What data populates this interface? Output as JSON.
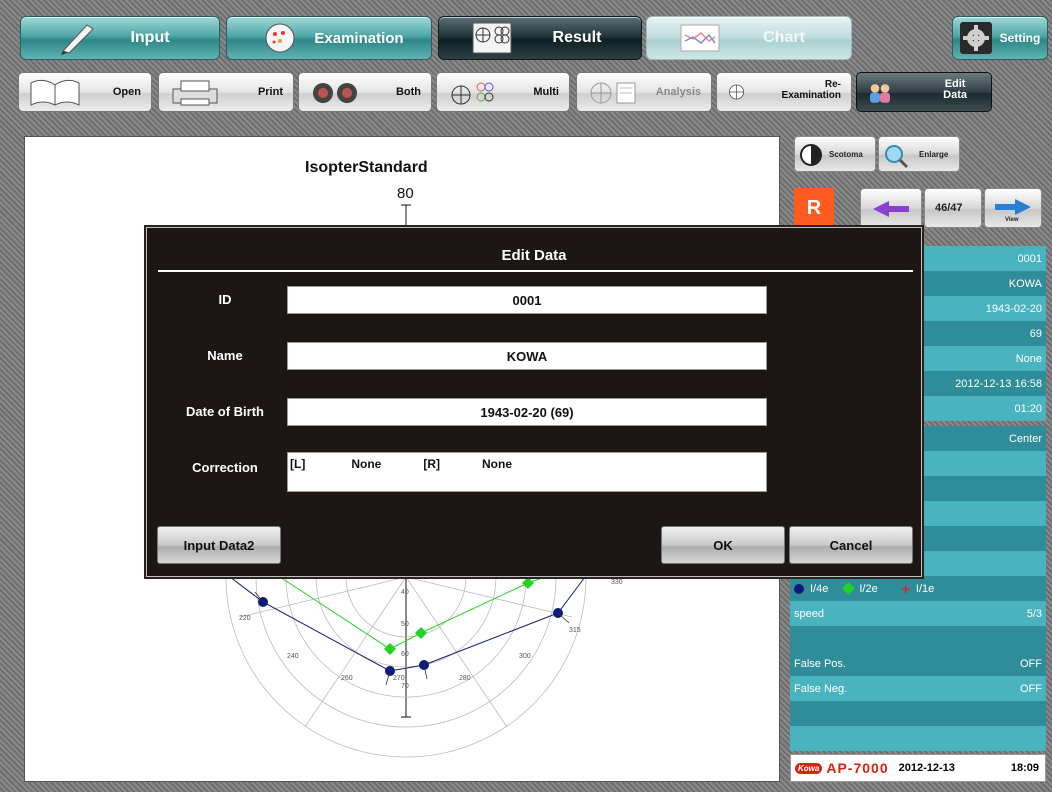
{
  "tabs": {
    "input": "Input",
    "examination": "Examination",
    "result": "Result",
    "chart": "Chart",
    "setting": "Setting"
  },
  "toolbar": {
    "open": "Open",
    "print": "Print",
    "both": "Both",
    "multi": "Multi",
    "analysis": "Analysis",
    "reexam_line1": "Re-",
    "reexam_line2": "Examination",
    "edit_line1": "Edit",
    "edit_line2": "Data"
  },
  "chart": {
    "title": "IsopterStandard",
    "top_tick": "80",
    "angles": [
      "220",
      "240",
      "260",
      "270",
      "280",
      "300",
      "315",
      "330"
    ],
    "scale": [
      "40",
      "50",
      "60",
      "70"
    ],
    "legend": [
      "I/4e",
      "I/2e",
      "I/1e"
    ]
  },
  "side": {
    "scotoma": "Scotoma",
    "enlarge": "Enlarge",
    "eye": "R",
    "page": "46/47",
    "view": "View",
    "rows": [
      {
        "label": "",
        "value": "0001"
      },
      {
        "label": "",
        "value": "KOWA"
      },
      {
        "label": "",
        "value": "1943-02-20"
      },
      {
        "label": "",
        "value": "69"
      },
      {
        "label": "",
        "value": "None"
      },
      {
        "label": "",
        "value": "2012-12-13 16:58"
      },
      {
        "label": "",
        "value": "01:20"
      }
    ],
    "center": "Center",
    "speed_label": "speed",
    "speed_value": "5/3",
    "false_pos_label": "False Pos.",
    "false_pos_value": "OFF",
    "false_neg_label": "False Neg.",
    "false_neg_value": "OFF",
    "footer_brand": "Kowa",
    "footer_model": "AP-7000",
    "footer_date": "2012-12-13",
    "footer_time": "18:09"
  },
  "modal": {
    "title": "Edit Data",
    "id_label": "ID",
    "id_value": "0001",
    "name_label": "Name",
    "name_value": "KOWA",
    "dob_label": "Date of Birth",
    "dob_value": "1943-02-20 (69)",
    "correction_label": "Correction",
    "corr_l_tag": "[L]",
    "corr_l_value": "None",
    "corr_r_tag": "[R]",
    "corr_r_value": "None",
    "input_data2": "Input Data2",
    "ok": "OK",
    "cancel": "Cancel"
  },
  "colors": {
    "teal_light": "#4ab3c0",
    "teal_dark": "#2f8d99",
    "isopter_blue": "#0d1a7a",
    "isopter_green": "#22d422",
    "isopter_red": "#e02020",
    "eye_badge": "#ff5a1f"
  }
}
